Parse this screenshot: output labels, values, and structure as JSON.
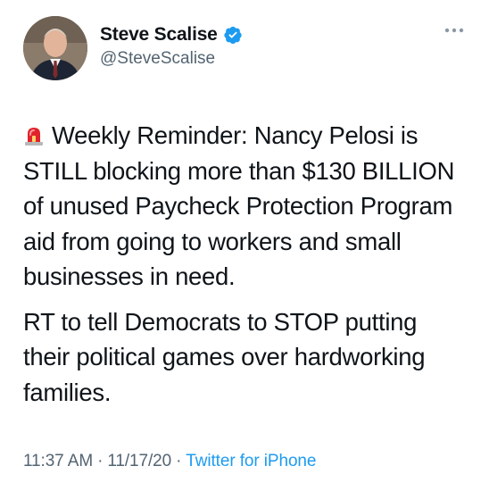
{
  "author": {
    "display_name": "Steve Scalise",
    "handle": "@SteveScalise",
    "verified": true
  },
  "tweet": {
    "paragraphs": [
      "Weekly Reminder: Nancy Pelosi is STILL blocking more than $130 BILLION of unused Paycheck Protection Program aid from going to workers and small businesses in need.",
      "RT to tell Democrats to STOP putting their political games over hardworking families."
    ],
    "lead_emoji": "police-car-light-icon"
  },
  "meta": {
    "time": "11:37 AM",
    "date": "11/17/20",
    "separator": "·",
    "source": "Twitter for iPhone"
  },
  "colors": {
    "text": "#0f1419",
    "secondary": "#536471",
    "link": "#1d9bf0",
    "verified": "#1d9bf0"
  }
}
